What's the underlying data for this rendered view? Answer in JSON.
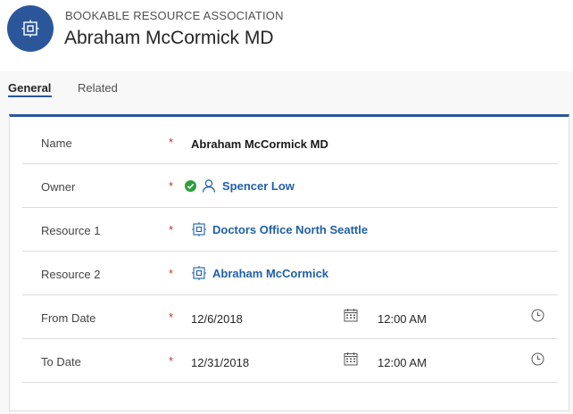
{
  "header": {
    "entity_type": "BOOKABLE RESOURCE ASSOCIATION",
    "record_title": "Abraham McCormick MD",
    "icon": "bookable-resource-icon",
    "accent_color": "#2b579a"
  },
  "tabs": [
    {
      "label": "General",
      "active": true
    },
    {
      "label": "Related",
      "active": false
    }
  ],
  "fields": {
    "name": {
      "label": "Name",
      "required": "*",
      "value": "Abraham McCormick MD"
    },
    "owner": {
      "label": "Owner",
      "required": "*",
      "value": "Spencer Low",
      "status_icon": "available-check-icon",
      "icon": "person-icon"
    },
    "resource1": {
      "label": "Resource 1",
      "required": "*",
      "value": "Doctors Office North Seattle",
      "icon": "resource-icon"
    },
    "resource2": {
      "label": "Resource 2",
      "required": "*",
      "value": "Abraham McCormick",
      "icon": "resource-icon"
    },
    "from_date": {
      "label": "From Date",
      "required": "*",
      "date": "12/6/2018",
      "time": "12:00 AM"
    },
    "to_date": {
      "label": "To Date",
      "required": "*",
      "date": "12/31/2018",
      "time": "12:00 AM"
    }
  }
}
